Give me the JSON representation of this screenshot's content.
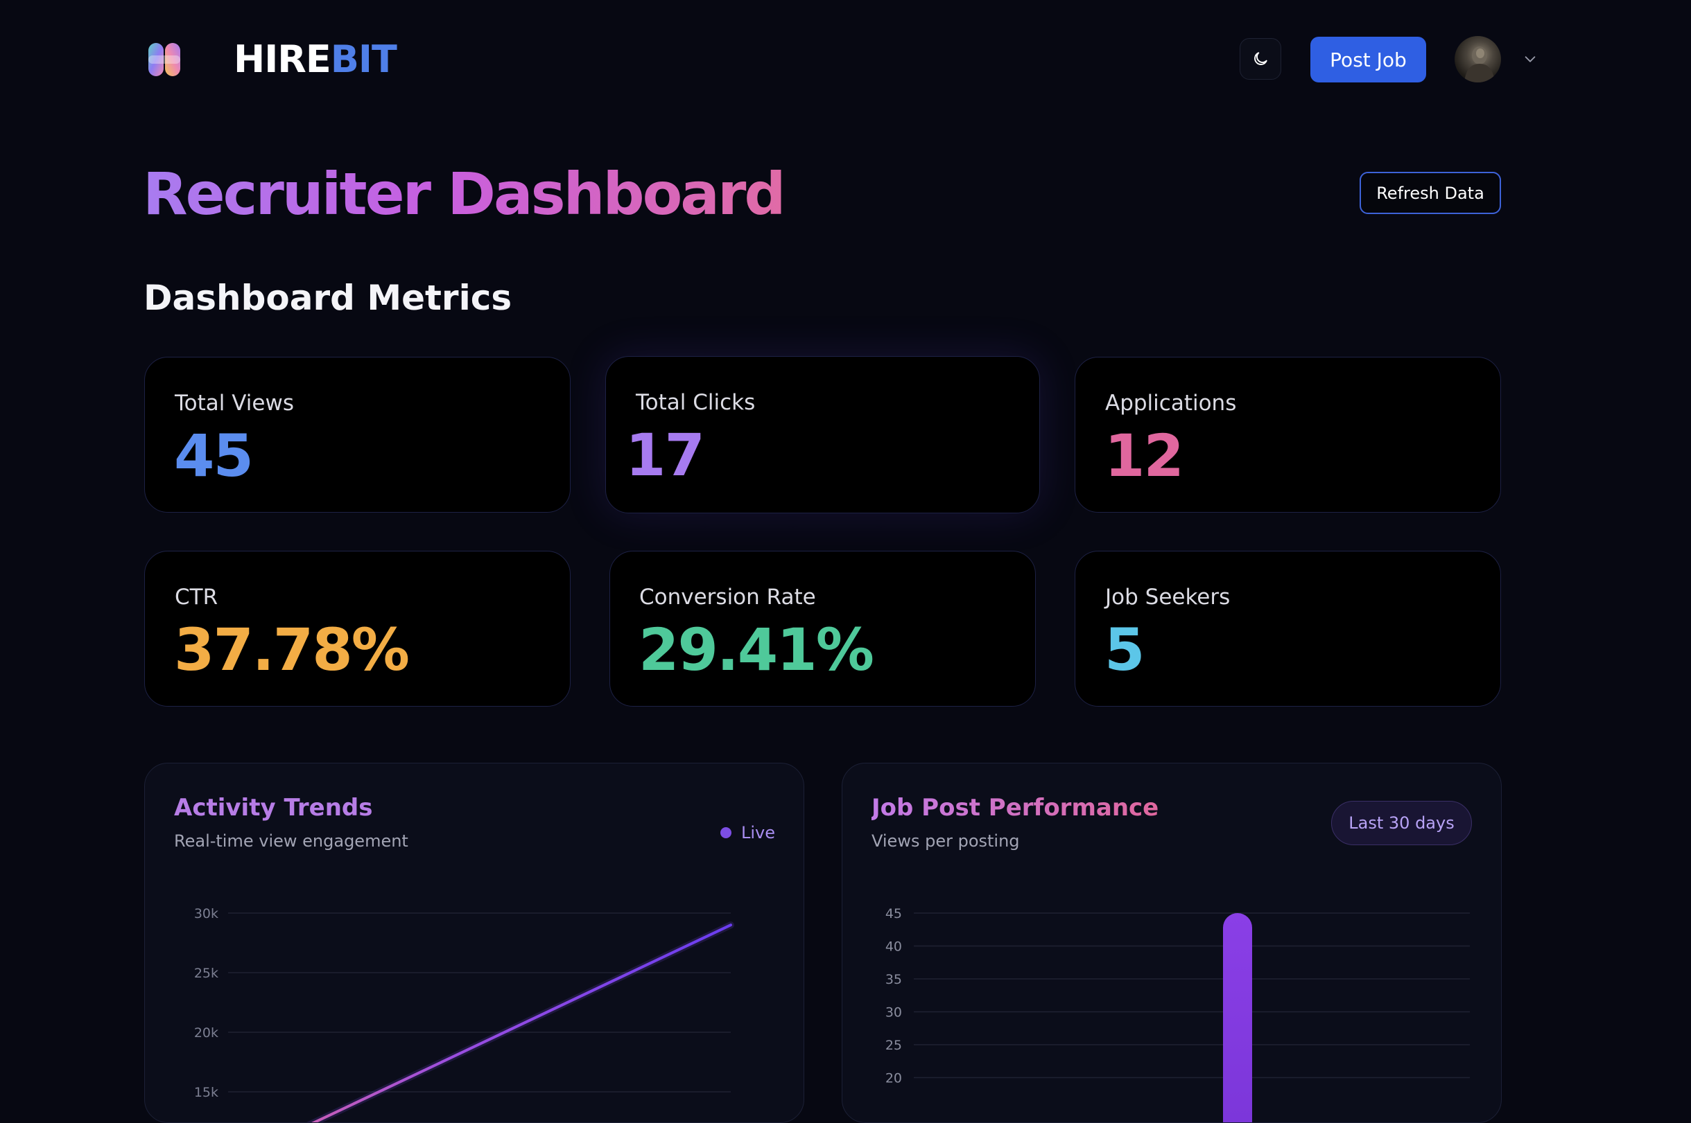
{
  "header": {
    "brand_part1": "HIRE",
    "brand_part2": "BIT",
    "theme_toggle_icon": "moon-icon",
    "post_job_label": "Post Job",
    "avatar_caret_icon": "chevron-down-icon"
  },
  "page": {
    "title": "Recruiter Dashboard",
    "refresh_label": "Refresh Data",
    "section_title": "Dashboard Metrics"
  },
  "metrics": [
    {
      "label": "Total Views",
      "value": "45",
      "color": "#5b8def"
    },
    {
      "label": "Total Clicks",
      "value": "17",
      "color": "#a77bf0"
    },
    {
      "label": "Applications",
      "value": "12",
      "color": "#e0679e"
    },
    {
      "label": "CTR",
      "value": "37.78%",
      "color": "#f3ad45"
    },
    {
      "label": "Conversion Rate",
      "value": "29.41%",
      "color": "#4fc99a"
    },
    {
      "label": "Job Seekers",
      "value": "5",
      "color": "#5cc6e8"
    }
  ],
  "activity_panel": {
    "title": "Activity Trends",
    "subtitle": "Real-time view engagement",
    "live_label": "Live"
  },
  "performance_panel": {
    "title": "Job Post Performance",
    "subtitle": "Views per posting",
    "range_label": "Last 30 days"
  },
  "colors": {
    "background": "#070812",
    "accent_blue": "#2f5fe3",
    "accent_purple": "#7c3fe0",
    "title_gradient_start": "#a87cf0",
    "title_gradient_end": "#e06ba6"
  },
  "chart_data": [
    {
      "type": "line",
      "title": "Activity Trends",
      "y_ticks": [
        "30k",
        "25k",
        "20k",
        "15k"
      ],
      "y_tick_values": [
        30000,
        25000,
        20000,
        15000
      ],
      "ylim_visible": [
        15000,
        30000
      ],
      "series": [
        {
          "points": [
            [
              0.0,
              9000
            ],
            [
              1.0,
              29000
            ]
          ]
        }
      ],
      "x_domain": [
        0,
        1
      ],
      "grid": true
    },
    {
      "type": "bar",
      "title": "Job Post Performance",
      "y_ticks": [
        "45",
        "40",
        "35",
        "30",
        "25",
        "20"
      ],
      "y_tick_values": [
        45,
        40,
        35,
        30,
        25,
        20
      ],
      "ylim_visible": [
        20,
        45
      ],
      "categories": [
        "",
        "",
        ""
      ],
      "values": [
        0,
        45,
        0
      ],
      "grid": true
    }
  ]
}
